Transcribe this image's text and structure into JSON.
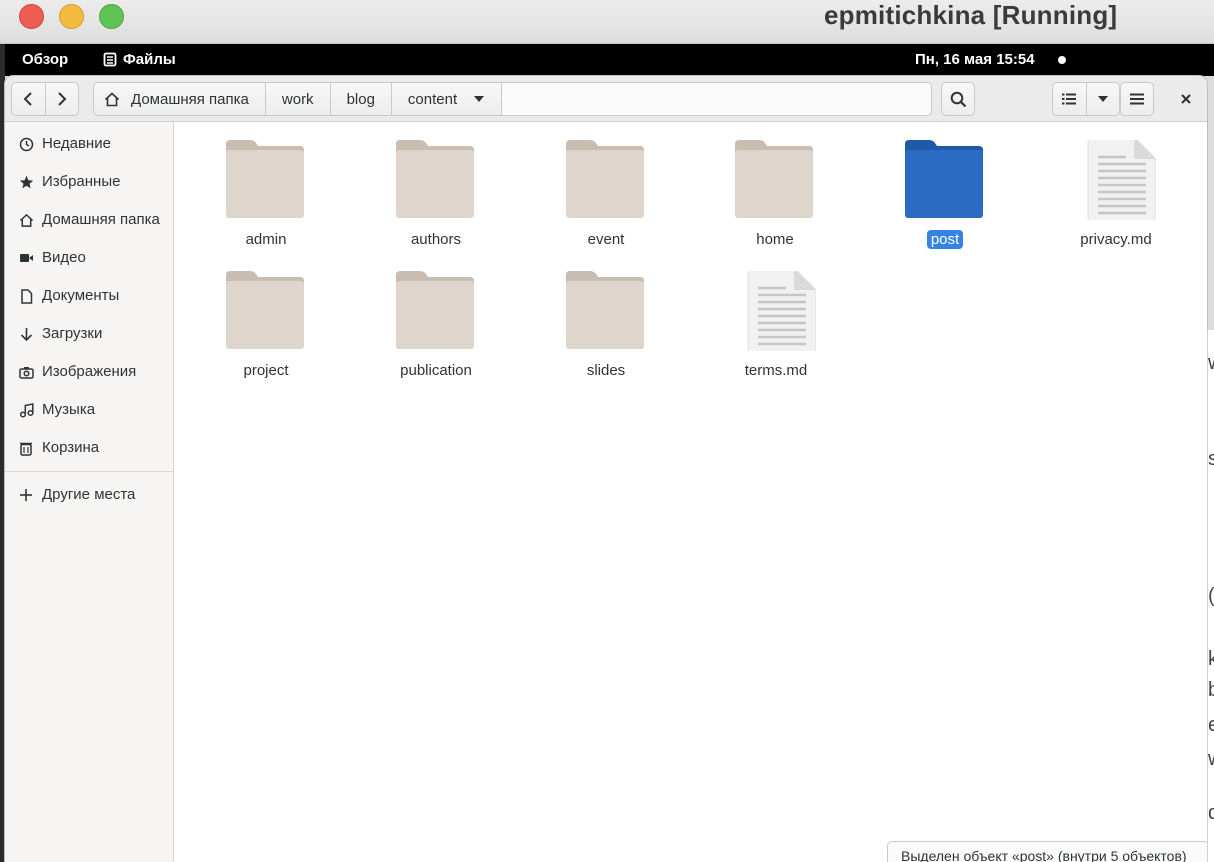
{
  "host": {
    "window_title": "epmitichkina [Running]"
  },
  "top_panel": {
    "activities": "Обзор",
    "app_name": "Файлы",
    "clock": "Пн, 16 мая  15:54"
  },
  "pathbar": {
    "crumbs": [
      "Домашняя папка",
      "work",
      "blog",
      "content"
    ]
  },
  "sidebar": {
    "items": [
      {
        "label": "Недавние",
        "icon": "clock-icon"
      },
      {
        "label": "Избранные",
        "icon": "star-icon"
      },
      {
        "label": "Домашняя папка",
        "icon": "home-icon"
      },
      {
        "label": "Видео",
        "icon": "video-icon"
      },
      {
        "label": "Документы",
        "icon": "document-icon"
      },
      {
        "label": "Загрузки",
        "icon": "download-icon"
      },
      {
        "label": "Изображения",
        "icon": "camera-icon"
      },
      {
        "label": "Музыка",
        "icon": "music-icon"
      },
      {
        "label": "Корзина",
        "icon": "trash-icon"
      }
    ],
    "other_places": "Другие места"
  },
  "files": [
    {
      "name": "admin",
      "kind": "folder"
    },
    {
      "name": "authors",
      "kind": "folder"
    },
    {
      "name": "event",
      "kind": "folder"
    },
    {
      "name": "home",
      "kind": "folder"
    },
    {
      "name": "post",
      "kind": "folder",
      "selected": true
    },
    {
      "name": "privacy.md",
      "kind": "file"
    },
    {
      "name": "project",
      "kind": "folder"
    },
    {
      "name": "publication",
      "kind": "folder"
    },
    {
      "name": "slides",
      "kind": "folder"
    },
    {
      "name": "terms.md",
      "kind": "file"
    }
  ],
  "status_bar": {
    "text": "Выделен объект «post» (внутри 5 объектов)"
  },
  "background_window": {
    "edge_glyphs": [
      "w",
      "s",
      "(",
      "k",
      "b",
      "e",
      "w",
      "d"
    ]
  },
  "colors": {
    "folder": "#ded6cd",
    "folder_tab": "#c9bdb1",
    "selected_folder": "#2a6bc4",
    "selected_folder_tab": "#1f5aa8",
    "selection": "#3584e4",
    "sidebar_bg": "#f6f5f4"
  }
}
